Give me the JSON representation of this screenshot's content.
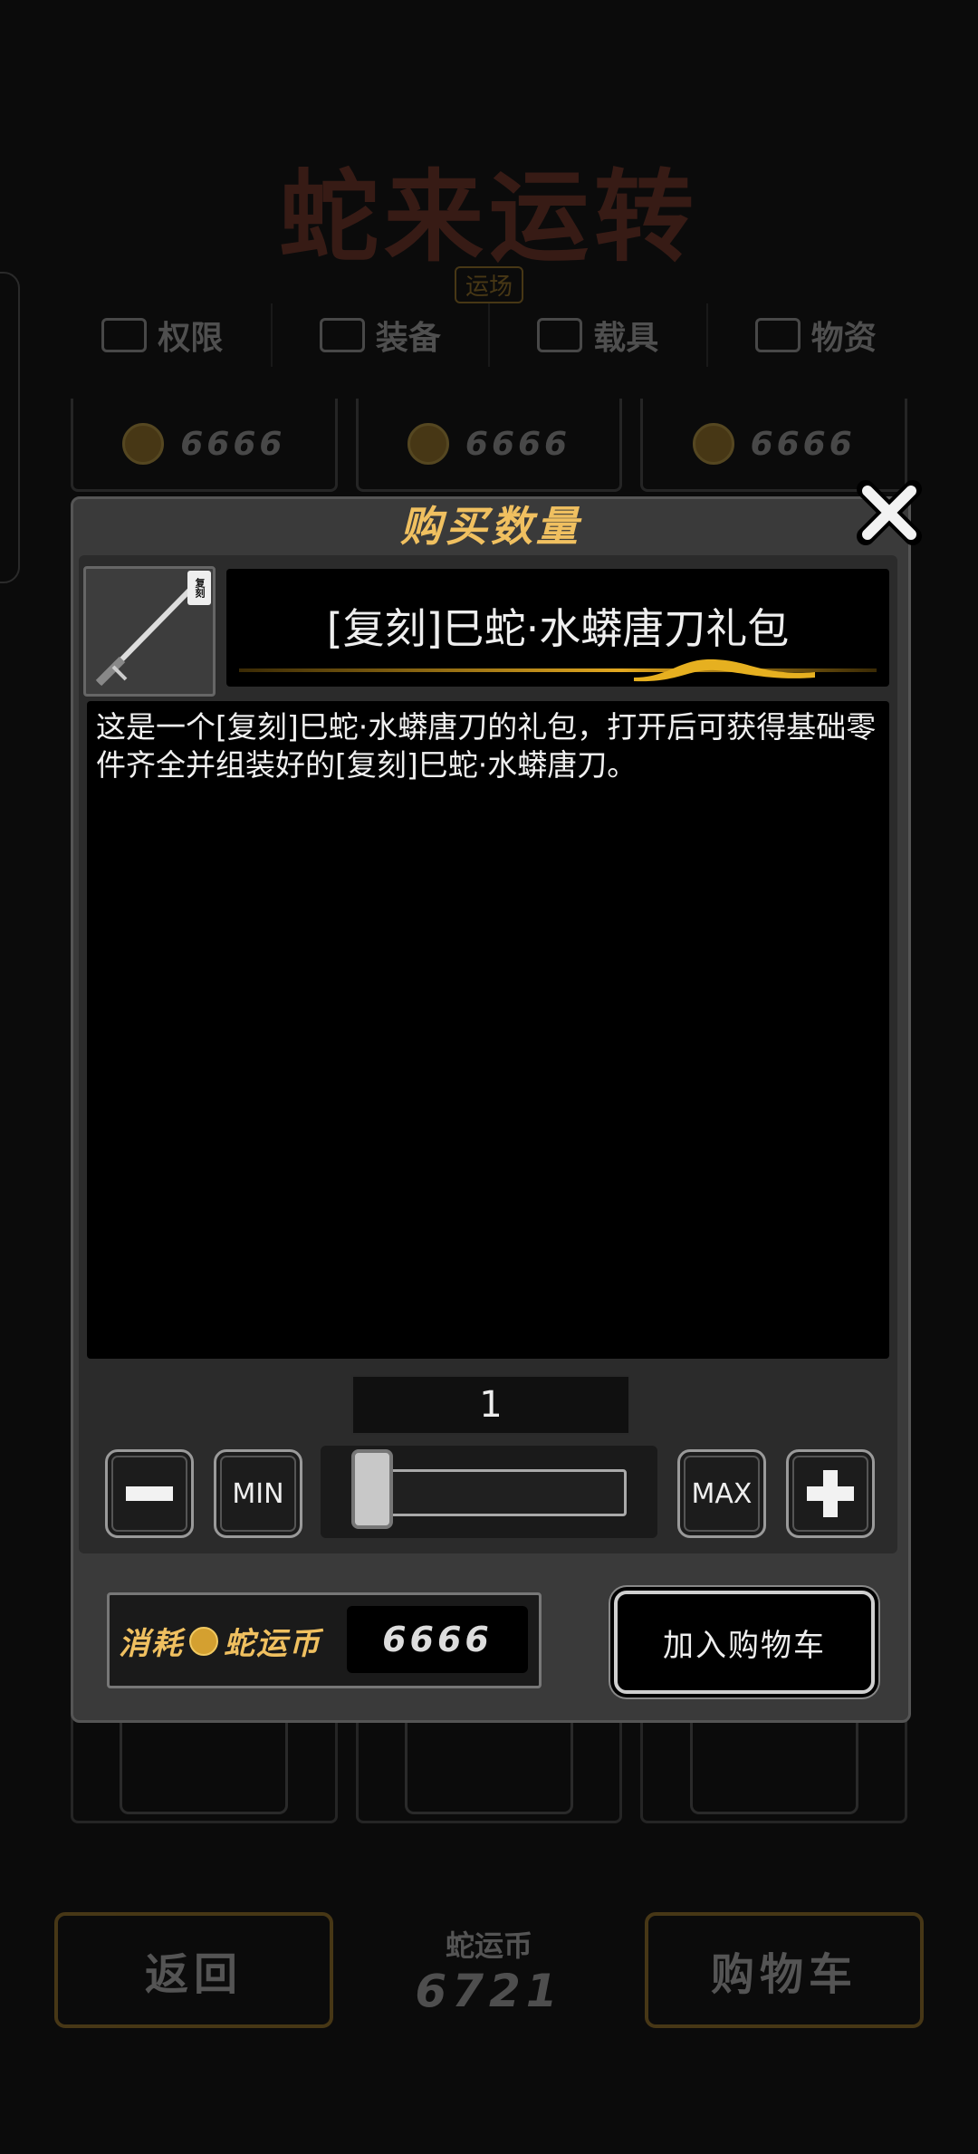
{
  "background": {
    "logo_title": "蛇来运转",
    "logo_subtitle": "运场",
    "tabs": [
      {
        "label": "权限"
      },
      {
        "label": "装备"
      },
      {
        "label": "载具"
      },
      {
        "label": "物资"
      }
    ],
    "card_prices": [
      "6666",
      "6666",
      "6666"
    ],
    "back_label": "返回",
    "currency_label": "蛇运币",
    "currency_balance": "6721",
    "cart_label": "购物车"
  },
  "dialog": {
    "title": "购买数量",
    "item_badge": "复刻",
    "item_name": "[复刻]巳蛇·水蟒唐刀礼包",
    "description": "这是一个[复刻]巳蛇·水蟒唐刀的礼包，打开后可获得基础零件齐全并组装好的[复刻]巳蛇·水蟒唐刀。",
    "quantity": "1",
    "quantity_fraction": 0.0,
    "min_label": "MIN",
    "max_label": "MAX",
    "cost_prefix": "消耗",
    "cost_currency": "蛇运币",
    "cost_value": "6666",
    "add_to_cart_label": "加入购物车"
  },
  "colors": {
    "accent_gold": "#f0c060",
    "panel": "#3a3a3a",
    "background": "#0b0b0b"
  }
}
